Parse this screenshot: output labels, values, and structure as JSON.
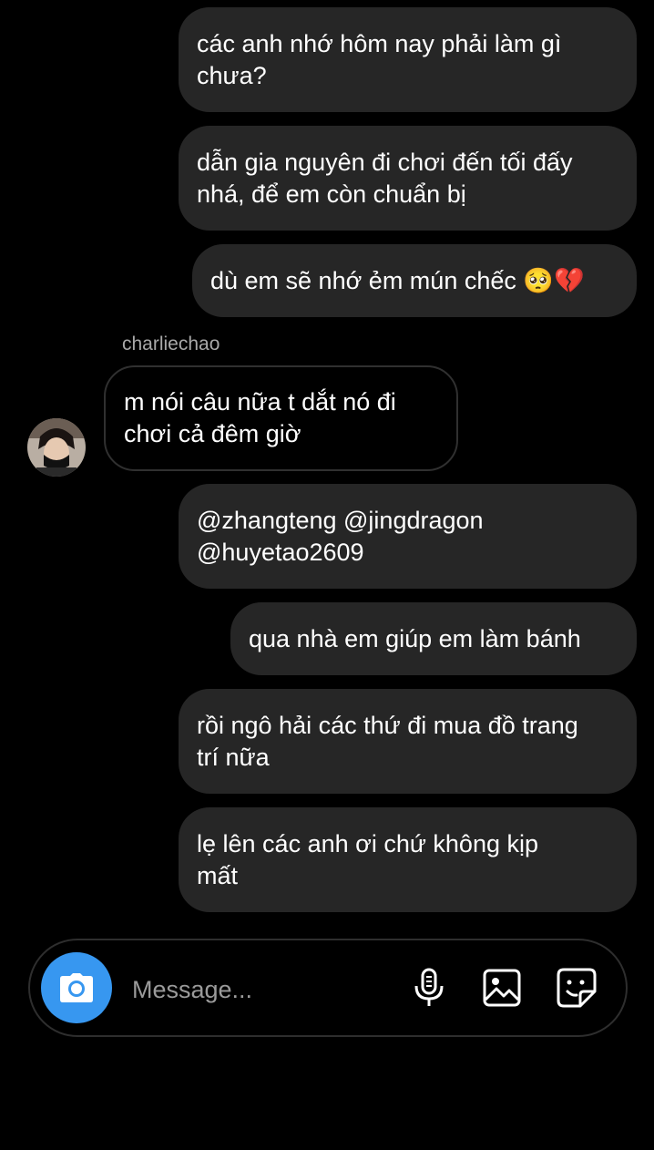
{
  "messages": [
    {
      "id": 1,
      "direction": "outgoing",
      "lines": [
        "các anh nhớ hôm nay phải làm gì",
        "chưa?"
      ]
    },
    {
      "id": 2,
      "direction": "outgoing",
      "lines": [
        "dẫn gia nguyên đi chơi đến tối đấy",
        "nhá, để em còn chuẩn bị"
      ]
    },
    {
      "id": 3,
      "direction": "outgoing",
      "text": "dù em sẽ nhớ ẻm mún chếc",
      "emoji": "🥺💔"
    },
    {
      "id": 4,
      "direction": "incoming",
      "sender": "charliechao",
      "lines": [
        "m nói câu nữa t dắt nó đi",
        "chơi cả đêm giờ"
      ]
    },
    {
      "id": 5,
      "direction": "outgoing",
      "lines": [
        "@zhangteng @jingdragon",
        "@huyetao2609"
      ]
    },
    {
      "id": 6,
      "direction": "outgoing",
      "text": "qua nhà em giúp em làm bánh"
    },
    {
      "id": 7,
      "direction": "outgoing",
      "lines": [
        "rồi ngô hải các thứ đi mua đồ trang",
        "trí nữa"
      ]
    },
    {
      "id": 8,
      "direction": "outgoing",
      "lines": [
        "lẹ lên các anh ơi chứ không kịp",
        "mất"
      ]
    }
  ],
  "composer": {
    "placeholder": "Message...",
    "icons": [
      "camera-icon",
      "microphone-icon",
      "gallery-icon",
      "sticker-icon"
    ]
  },
  "colors": {
    "background": "#000000",
    "bubble_outgoing": "#262626",
    "bubble_incoming_border": "#303030",
    "camera_button": "#3797f0",
    "sender_name": "#a8a8a8"
  }
}
